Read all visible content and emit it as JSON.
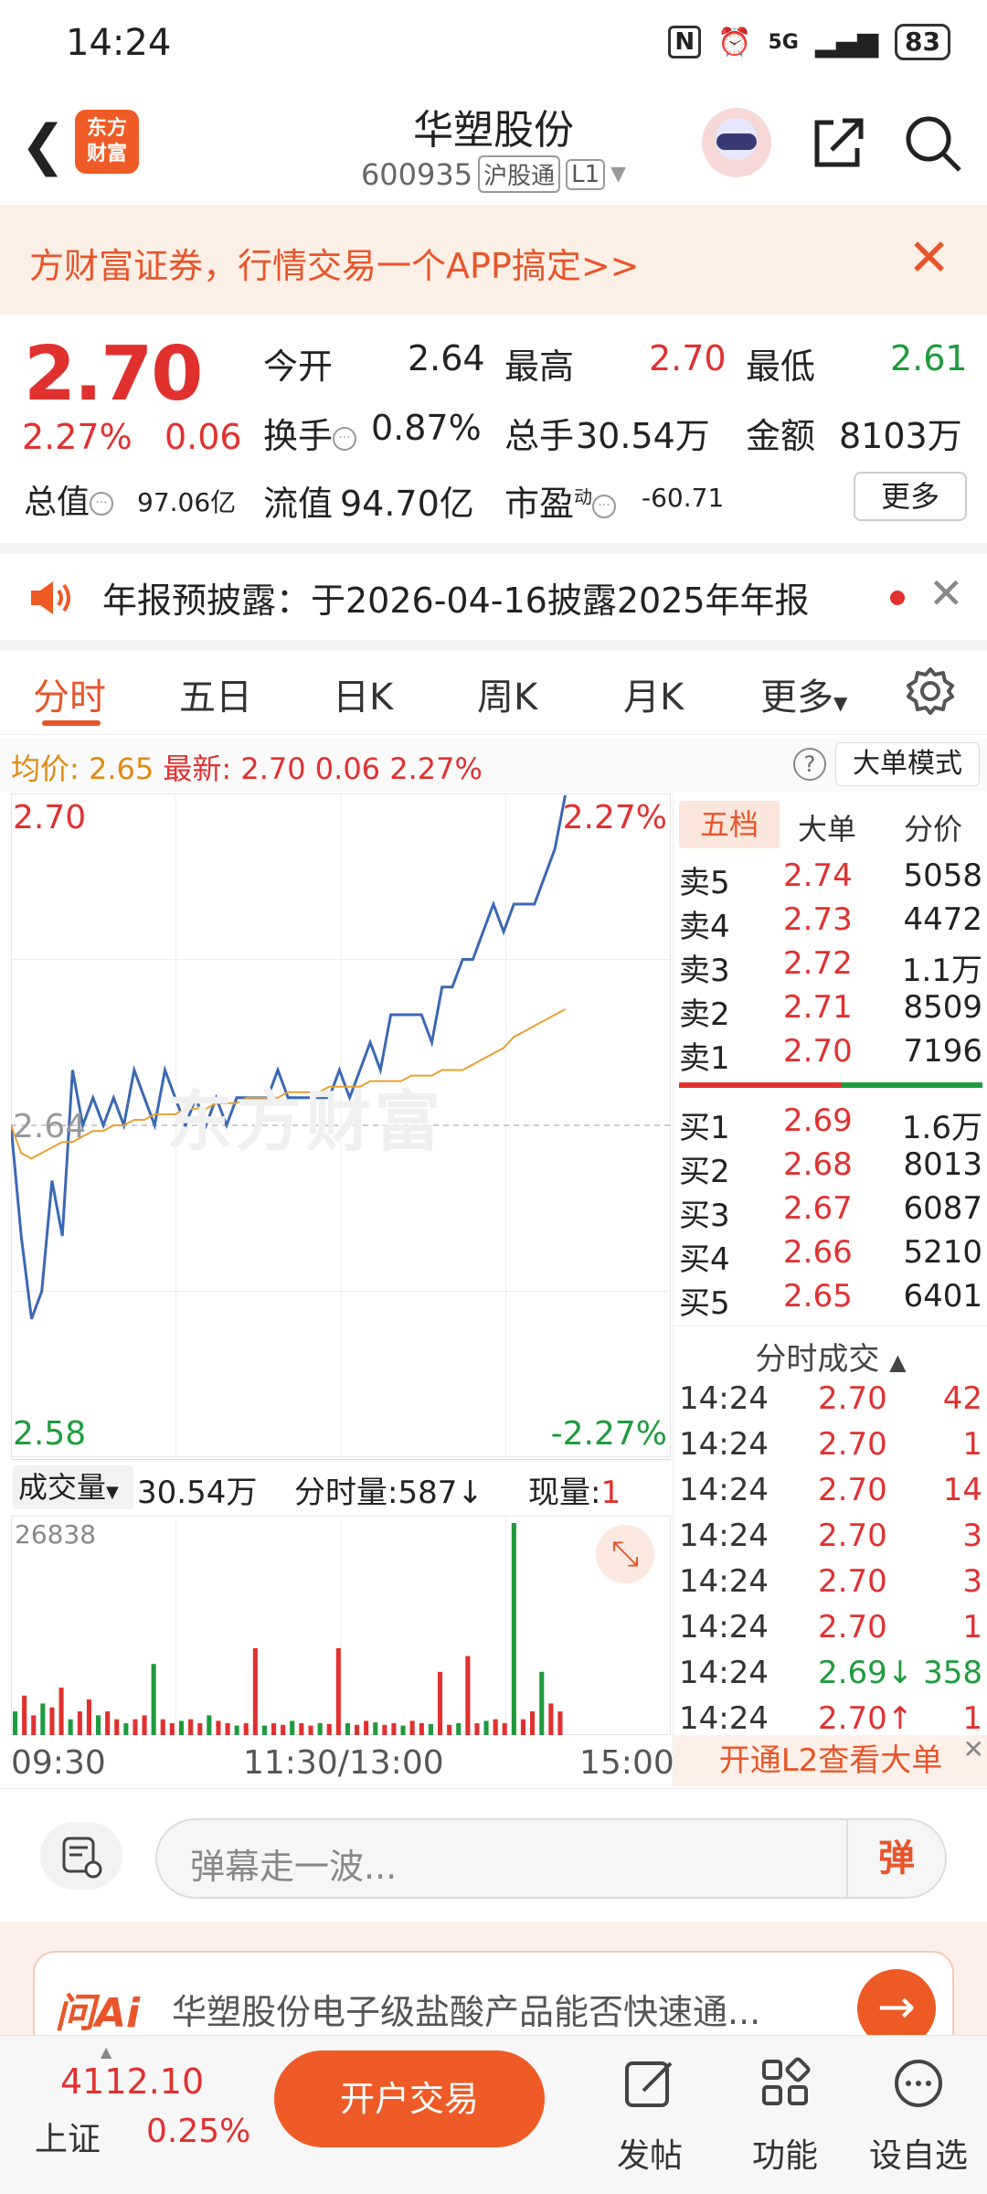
{
  "status": {
    "time": "14:24",
    "network": "5G",
    "battery": "83"
  },
  "header": {
    "logo": [
      "东方",
      "财富"
    ],
    "title": "华塑股份",
    "code": "600935",
    "tag_market": "沪股通",
    "tag_level": "L1"
  },
  "promo": {
    "text": "方财富证券，行情交易一个APP搞定>>"
  },
  "quote": {
    "price": "2.70",
    "change_pct": "2.27%",
    "change": "0.06",
    "open_label": "今开",
    "open": "2.64",
    "high_label": "最高",
    "high": "2.70",
    "low_label": "最低",
    "low": "2.61",
    "turnover_label": "换手",
    "turnover": "0.87%",
    "volume_label": "总手",
    "volume": "30.54万",
    "amount_label": "金额",
    "amount": "8103万",
    "mktcap_label": "总值",
    "mktcap": "97.06亿",
    "float_label": "流值",
    "float": "94.70亿",
    "pe_label": "市盈",
    "pe_sup": "动",
    "pe": "-60.71",
    "more": "更多"
  },
  "notice": {
    "text": "年报预披露：于2026-04-16披露2025年年报"
  },
  "tabs": [
    "分时",
    "五日",
    "日K",
    "周K",
    "月K",
    "更多"
  ],
  "infobar": {
    "avg_label": "均价:",
    "avg": "2.65",
    "latest_label": "最新:",
    "latest": "2.70",
    "chg": "0.06",
    "pct": "2.27%",
    "mode": "大单模式"
  },
  "chart_data": {
    "type": "line",
    "top_price": "2.70",
    "top_pct": "2.27%",
    "mid_price": "2.64",
    "bottom_price": "2.58",
    "bottom_pct": "-2.27%",
    "ylim": [
      2.58,
      2.7
    ],
    "series": [
      {
        "values": [
          2.64,
          2.62,
          2.605,
          2.61,
          2.63,
          2.62,
          2.65,
          2.64,
          2.645,
          2.64,
          2.645,
          2.64,
          2.65,
          2.645,
          2.64,
          2.65,
          2.645,
          2.64,
          2.645,
          2.64,
          2.645,
          2.64,
          2.645,
          2.645,
          2.645,
          2.645,
          2.65,
          2.645,
          2.645,
          2.645,
          2.645,
          2.645,
          2.65,
          2.645,
          2.65,
          2.655,
          2.65,
          2.66,
          2.66,
          2.66,
          2.66,
          2.655,
          2.665,
          2.665,
          2.67,
          2.67,
          2.675,
          2.68,
          2.675,
          2.68,
          2.68,
          2.68,
          2.685,
          2.69,
          2.7
        ]
      },
      {
        "values": [
          2.64,
          2.635,
          2.634,
          2.635,
          2.636,
          2.637,
          2.637,
          2.638,
          2.639,
          2.639,
          2.64,
          2.64,
          2.641,
          2.641,
          2.642,
          2.642,
          2.642,
          2.643,
          2.643,
          2.643,
          2.644,
          2.644,
          2.644,
          2.645,
          2.645,
          2.645,
          2.645,
          2.646,
          2.646,
          2.646,
          2.646,
          2.647,
          2.647,
          2.647,
          2.647,
          2.648,
          2.648,
          2.648,
          2.648,
          2.649,
          2.649,
          2.649,
          2.65,
          2.65,
          2.65,
          2.651,
          2.652,
          2.653,
          2.654,
          2.656,
          2.657,
          2.658,
          2.659,
          2.66,
          2.661
        ]
      }
    ],
    "volume": {
      "max_label": "26838",
      "values": [
        3000,
        5000,
        2500,
        4000,
        3500,
        6000,
        2000,
        3000,
        4500,
        2500,
        3000,
        2000,
        1500,
        2000,
        2500,
        9000,
        2000,
        1500,
        1800,
        2000,
        1500,
        2500,
        1800,
        1500,
        1200,
        1500,
        11000,
        1200,
        1500,
        1300,
        1800,
        1500,
        1200,
        1500,
        1400,
        11000,
        1500,
        1300,
        1800,
        1600,
        1300,
        1500,
        1200,
        1800,
        1500,
        1400,
        8000,
        1300,
        1500,
        10000,
        1500,
        1800,
        2000,
        1500,
        26838,
        2000,
        3000,
        8000,
        4000,
        3000
      ]
    }
  },
  "volhdr": {
    "type": "成交量",
    "total": "30.54万",
    "minute_label": "分时量:",
    "minute": "587",
    "current_label": "现量:",
    "current": "1"
  },
  "time_axis": [
    "09:30",
    "11:30/13:00",
    "15:00"
  ],
  "book": {
    "tabs": [
      "五档",
      "大单",
      "分价"
    ],
    "asks": [
      {
        "name": "卖5",
        "price": "2.74",
        "vol": "5058"
      },
      {
        "name": "卖4",
        "price": "2.73",
        "vol": "4472"
      },
      {
        "name": "卖3",
        "price": "2.72",
        "vol": "1.1万"
      },
      {
        "name": "卖2",
        "price": "2.71",
        "vol": "8509"
      },
      {
        "name": "卖1",
        "price": "2.70",
        "vol": "7196"
      }
    ],
    "bids": [
      {
        "name": "买1",
        "price": "2.69",
        "vol": "1.6万"
      },
      {
        "name": "买2",
        "price": "2.68",
        "vol": "8013"
      },
      {
        "name": "买3",
        "price": "2.67",
        "vol": "6087"
      },
      {
        "name": "买4",
        "price": "2.66",
        "vol": "5210"
      },
      {
        "name": "买5",
        "price": "2.65",
        "vol": "6401"
      }
    ],
    "trades_header": "分时成交",
    "trades": [
      {
        "time": "14:24",
        "price": "2.70",
        "vol": "42",
        "dir": ""
      },
      {
        "time": "14:24",
        "price": "2.70",
        "vol": "1",
        "dir": ""
      },
      {
        "time": "14:24",
        "price": "2.70",
        "vol": "14",
        "dir": ""
      },
      {
        "time": "14:24",
        "price": "2.70",
        "vol": "3",
        "dir": ""
      },
      {
        "time": "14:24",
        "price": "2.70",
        "vol": "3",
        "dir": ""
      },
      {
        "time": "14:24",
        "price": "2.70",
        "vol": "1",
        "dir": ""
      },
      {
        "time": "14:24",
        "price": "2.69",
        "vol": "358",
        "dir": "↓"
      },
      {
        "time": "14:24",
        "price": "2.70",
        "vol": "1",
        "dir": "↑"
      }
    ],
    "l2_text": "开通L2查看大单"
  },
  "danmu": {
    "placeholder": "弹幕走一波...",
    "send": "弹"
  },
  "ai": {
    "logo": "问Ai",
    "question": "华塑股份电子级盐酸产品能否快速通..."
  },
  "bottom": {
    "index_value": "4112.10",
    "index_name": "上证",
    "index_pct": "0.25%",
    "trade": "开户交易",
    "nav": [
      "发帖",
      "功能",
      "设自选"
    ]
  }
}
